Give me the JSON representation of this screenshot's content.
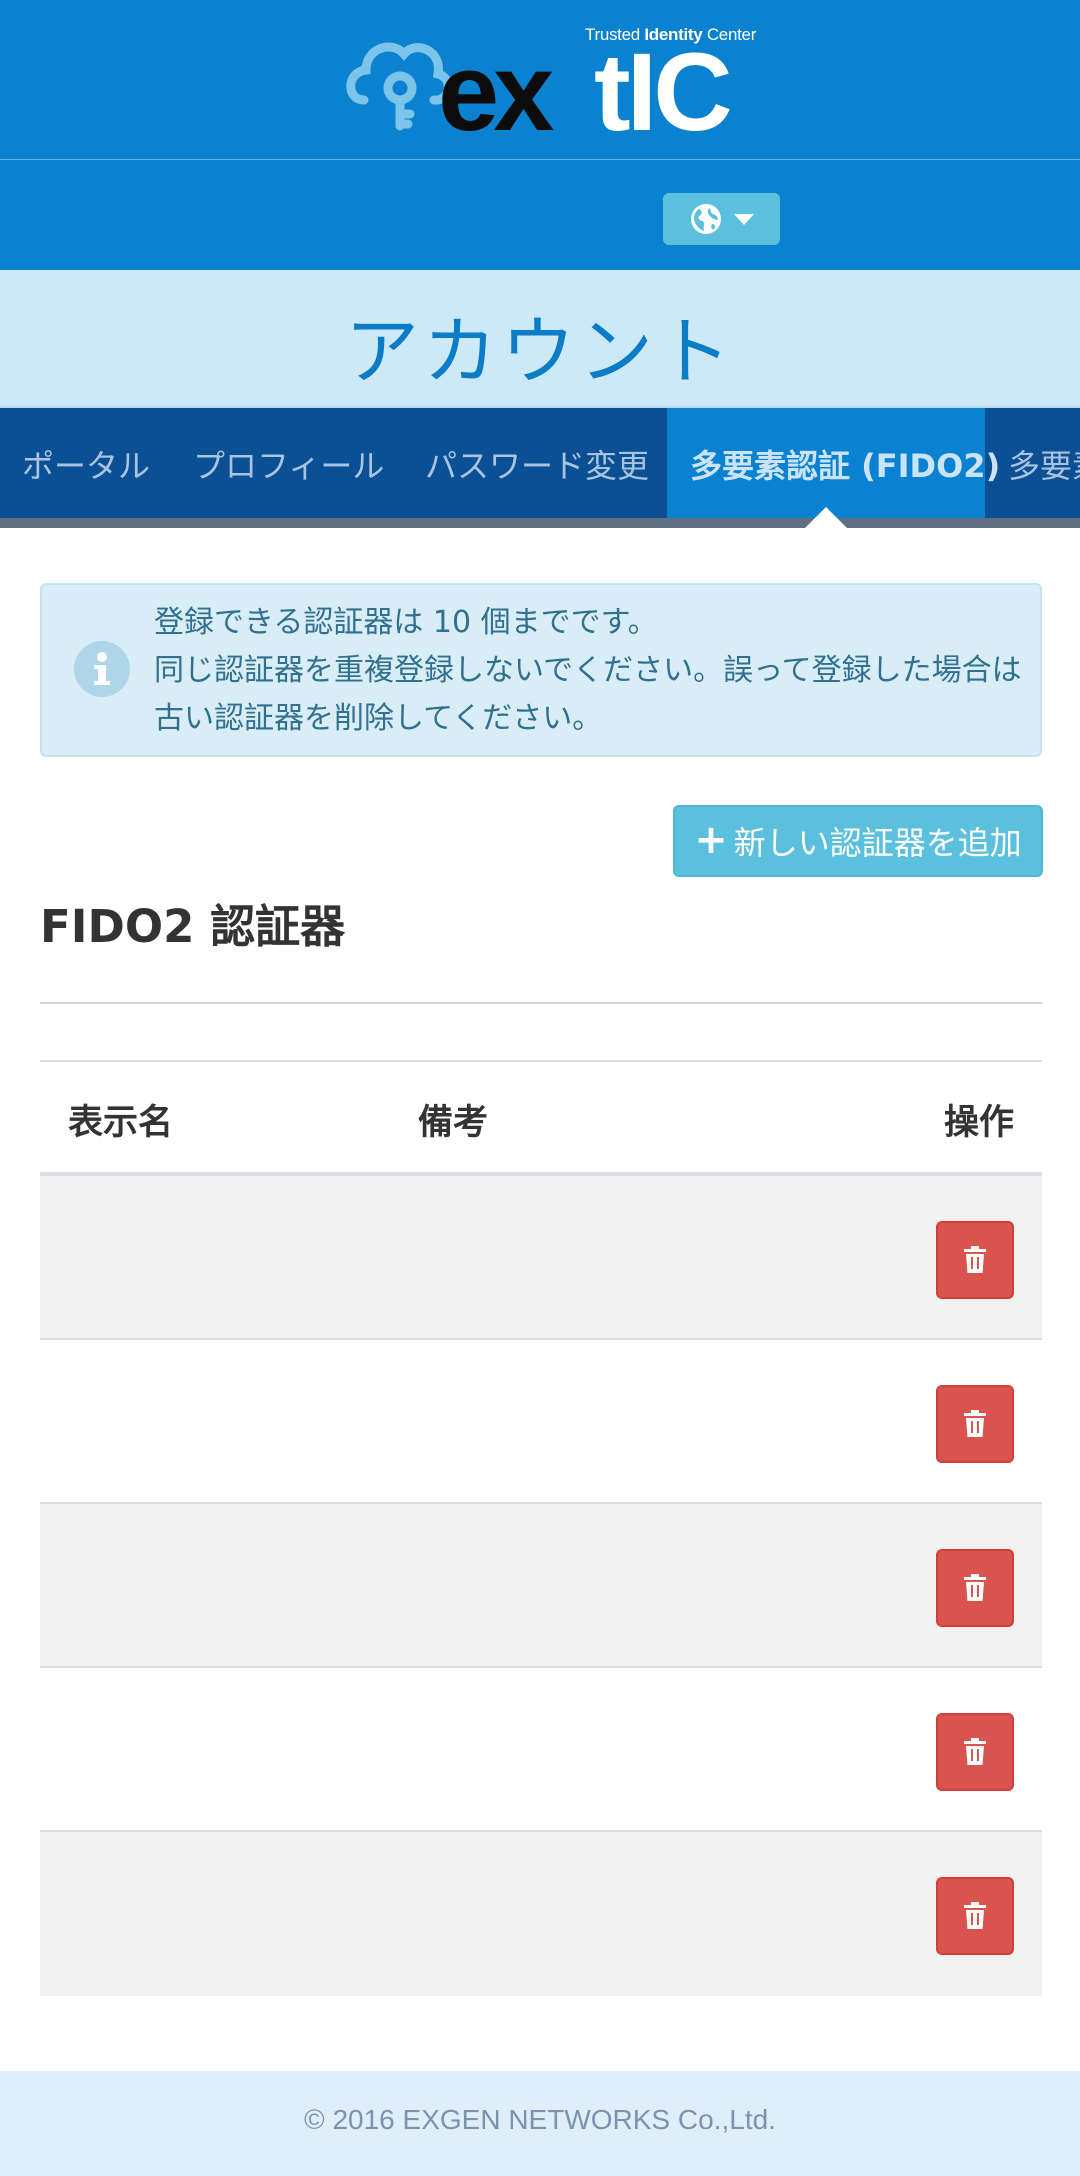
{
  "header": {
    "logo_text": "extic",
    "tagline_prefix": "Trusted",
    "tagline_bold": "Identity",
    "tagline_suffix": "Center",
    "language_icon": "globe-icon"
  },
  "page": {
    "title": "アカウント"
  },
  "tabs": [
    {
      "label": "ポータル",
      "active": false
    },
    {
      "label": "プロフィール",
      "active": false
    },
    {
      "label": "パスワード変更",
      "active": false
    },
    {
      "label": "多要素認証 (FIDO2)",
      "active": true
    },
    {
      "label": "多要素",
      "active": false
    }
  ],
  "alert": {
    "icon": "info-icon",
    "line1": "登録できる認証器は 10 個までです。",
    "line2": "同じ認証器を重複登録しないでください。誤って登録した場合は古い認証器を削除してください。"
  },
  "add_button": {
    "label": "新しい認証器を追加",
    "icon": "plus-icon"
  },
  "section": {
    "heading": "FIDO2 認証器"
  },
  "table": {
    "columns": [
      "表示名",
      "備考",
      "操作"
    ],
    "rows": [
      {
        "display_name": "",
        "note": ""
      },
      {
        "display_name": "",
        "note": ""
      },
      {
        "display_name": "",
        "note": ""
      },
      {
        "display_name": "",
        "note": ""
      },
      {
        "display_name": "",
        "note": ""
      }
    ],
    "delete_icon": "trash-icon"
  },
  "footer": {
    "copyright": "© 2016 EXGEN NETWORKS Co.,Ltd."
  },
  "colors": {
    "header_blue": "#0a82cf",
    "title_band": "#cde8f7",
    "tabs_bg": "#0b4f94",
    "tab_active": "#0b82d1",
    "info_bg": "#d9edf7",
    "info_button": "#5bc0de",
    "danger": "#d9534f"
  }
}
